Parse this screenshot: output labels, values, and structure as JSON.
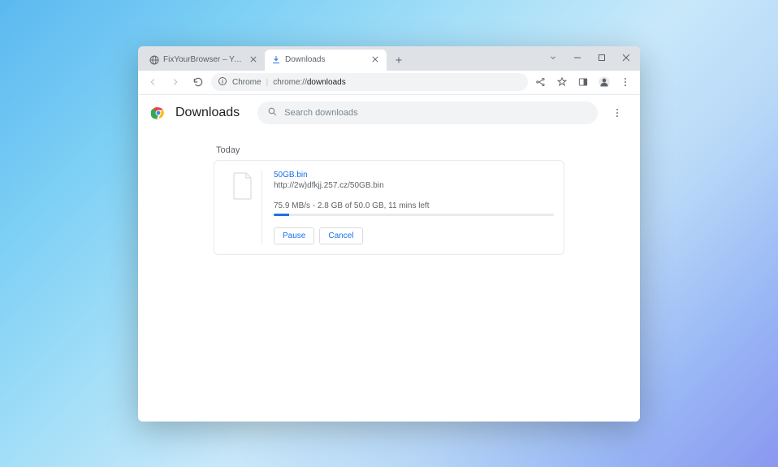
{
  "window": {
    "tabs": [
      {
        "title": "FixYourBrowser – Your Trusted C…",
        "active": false
      },
      {
        "title": "Downloads",
        "active": true
      }
    ],
    "omnibox": {
      "chrome_label": "Chrome",
      "divider": "|",
      "host": "chrome://",
      "path": "downloads"
    }
  },
  "page": {
    "title": "Downloads",
    "search_placeholder": "Search downloads",
    "section": "Today",
    "download": {
      "filename": "50GB.bin",
      "source_url": "http://2w)dfkjj.257.cz/50GB.bin",
      "status": "75.9 MB/s - 2.8 GB of 50.0 GB, 11 mins left",
      "progress_percent": 5.6,
      "actions": {
        "pause": "Pause",
        "cancel": "Cancel"
      }
    }
  }
}
